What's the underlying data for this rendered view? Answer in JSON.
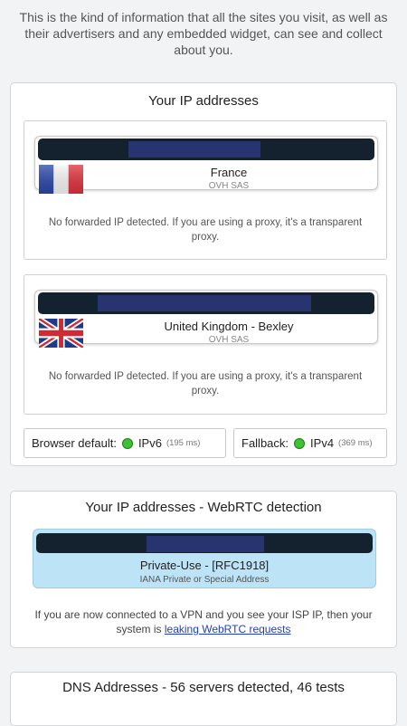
{
  "intro_text": "This is the kind of information that all the sites you visit, as well as their advertisers and any embedded widget, can see and collect about you.",
  "ip_section": {
    "title": "Your IP addresses",
    "entries": [
      {
        "country": "France",
        "isp": "OVH SAS",
        "flag": "france-flag-icon",
        "proxy_note": "No forwarded IP detected. If you are using a proxy, it's a transparent proxy."
      },
      {
        "country": "United Kingdom - Bexley",
        "isp": "OVH SAS",
        "flag": "uk-flag-icon",
        "proxy_note": "No forwarded IP detected. If you are using a proxy, it's a transparent proxy."
      }
    ],
    "browser_default": {
      "label": "Browser default:",
      "protocol": "IPv6",
      "latency": "(195 ms)"
    },
    "fallback": {
      "label": "Fallback:",
      "protocol": "IPv4",
      "latency": "(369 ms)"
    }
  },
  "webrtc_section": {
    "title": "Your IP addresses - WebRTC detection",
    "type": "Private-Use - [RFC1918]",
    "subtype": "IANA Private or Special Address",
    "note_before": "If you are now connected to a VPN and you see your ISP IP, then your system is",
    "link_text": "leaking WebRTC requests"
  },
  "dns_section": {
    "title": "DNS Addresses - 56 servers detected, 46 tests"
  },
  "colors": {
    "ok_dot": "#3cc232",
    "link": "#1f3fbf",
    "webrtc_bg": "#bde3f7",
    "ip_bar": "#14222f",
    "ip_mask": "#28346f"
  }
}
